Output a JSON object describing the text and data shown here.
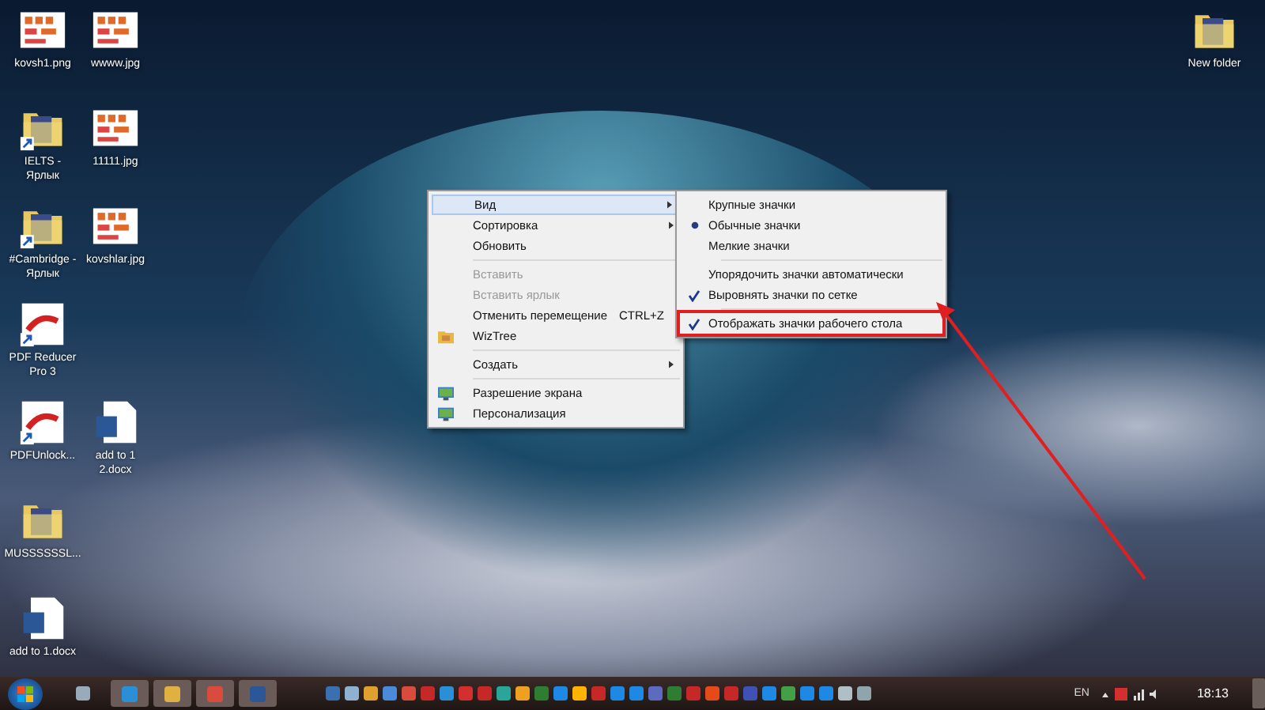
{
  "desktop_icons": [
    {
      "label": "kovsh1.png",
      "kind": "image",
      "shortcut": false
    },
    {
      "label": "wwww.jpg",
      "kind": "image",
      "shortcut": false
    },
    {
      "label": "IELTS - Ярлык",
      "kind": "folder",
      "shortcut": true
    },
    {
      "label": "11111.jpg",
      "kind": "image",
      "shortcut": false
    },
    {
      "label": "#Cambridge - Ярлык",
      "kind": "folder",
      "shortcut": true
    },
    {
      "label": "kovshlar.jpg",
      "kind": "image",
      "shortcut": false
    },
    {
      "label": "PDF Reducer Pro 3",
      "kind": "pdf",
      "shortcut": true
    },
    {
      "label": "PDFUnlock...",
      "kind": "pdf",
      "shortcut": true
    },
    {
      "label": "add to 1 2.docx",
      "kind": "word",
      "shortcut": false
    },
    {
      "label": "MUSSSSSSL...",
      "kind": "folder",
      "shortcut": false
    },
    {
      "label": "add to 1.docx",
      "kind": "word",
      "shortcut": false
    },
    {
      "label": "New folder",
      "kind": "folder",
      "shortcut": false
    }
  ],
  "context_menu": {
    "items": [
      {
        "kind": "item",
        "label": "Вид",
        "submenu": true,
        "selected": true,
        "disabled": false
      },
      {
        "kind": "item",
        "label": "Сортировка",
        "submenu": true,
        "selected": false,
        "disabled": false
      },
      {
        "kind": "item",
        "label": "Обновить",
        "submenu": false,
        "selected": false,
        "disabled": false
      },
      {
        "kind": "separator"
      },
      {
        "kind": "item",
        "label": "Вставить",
        "submenu": false,
        "selected": false,
        "disabled": true
      },
      {
        "kind": "item",
        "label": "Вставить ярлык",
        "submenu": false,
        "selected": false,
        "disabled": true
      },
      {
        "kind": "item",
        "label": "Отменить перемещение",
        "shortcut": "CTRL+Z",
        "submenu": false,
        "selected": false,
        "disabled": false
      },
      {
        "kind": "app",
        "label": "WizTree",
        "submenu": false,
        "selected": false,
        "disabled": false
      },
      {
        "kind": "separator"
      },
      {
        "kind": "item",
        "label": "Создать",
        "submenu": true,
        "selected": false,
        "disabled": false
      },
      {
        "kind": "separator"
      },
      {
        "kind": "display",
        "label": "Разрешение экрана",
        "submenu": false,
        "selected": false,
        "disabled": false
      },
      {
        "kind": "display",
        "label": "Персонализация",
        "submenu": false,
        "selected": false,
        "disabled": false
      }
    ]
  },
  "view_submenu": {
    "items": [
      {
        "kind": "radio",
        "label": "Крупные значки",
        "selected": false,
        "highlighted": false
      },
      {
        "kind": "radio",
        "label": "Обычные значки",
        "selected": true,
        "highlighted": false
      },
      {
        "kind": "radio",
        "label": "Мелкие значки",
        "selected": false,
        "highlighted": false
      },
      {
        "kind": "separator"
      },
      {
        "kind": "check",
        "label": "Упорядочить значки автоматически",
        "checked": false,
        "highlighted": false
      },
      {
        "kind": "check",
        "label": "Выровнять значки по сетке",
        "checked": true,
        "highlighted": false
      },
      {
        "kind": "separator"
      },
      {
        "kind": "check",
        "label": "Отображать значки рабочего стола",
        "checked": true,
        "highlighted": true
      }
    ]
  },
  "taskbar": {
    "tray": {
      "language": "EN",
      "time": "18:13"
    }
  }
}
